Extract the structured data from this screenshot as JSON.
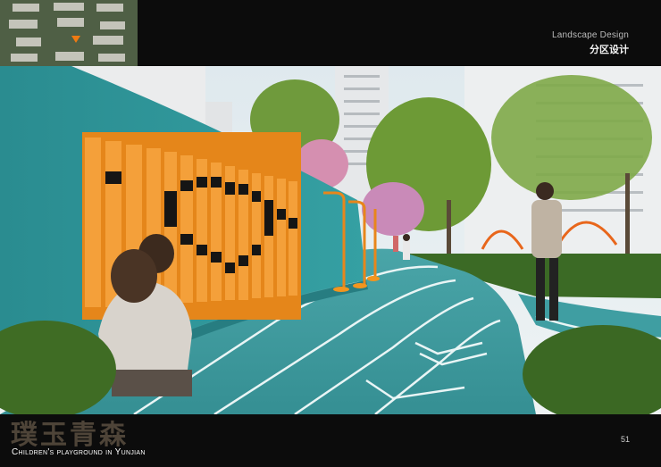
{
  "header": {
    "title_en": "Landscape Design",
    "title_cn": "分区设计"
  },
  "minimap": {
    "marker_color": "#f07a12"
  },
  "scene": {
    "colors": {
      "wall": "#2f9397",
      "track": "#3f9ea2",
      "track_lines": "#e9f5f5",
      "panel_orange": "#f2951e",
      "sky": "#e4eef3"
    }
  },
  "footer": {
    "brand_cn": "璞玉青森",
    "brand_en": "Children's playground in Yunjian",
    "page_number": "51"
  }
}
